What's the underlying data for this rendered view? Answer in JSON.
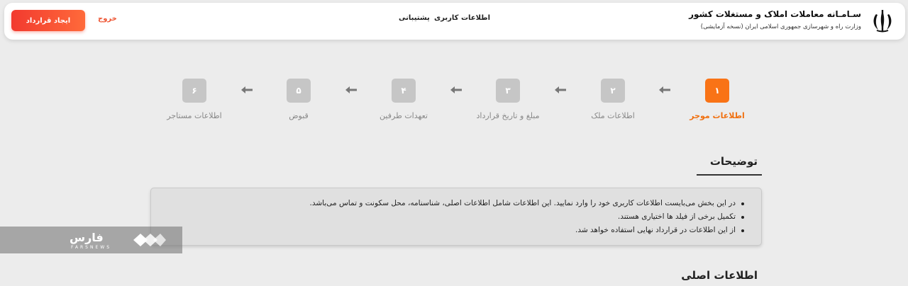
{
  "header": {
    "title": "سـامـانه معاملات املاک و مستغلات کشور",
    "subtitle": "وزارت راه و شهرسازی جمهوری اسلامی ایران (نسخه آزمایشی)",
    "nav": {
      "user_info": "اطلاعات کاربری",
      "support": "پشتیبانی"
    },
    "logout": "خروج",
    "create_contract": "ایجاد قرارداد"
  },
  "steps": [
    {
      "num": "۱",
      "label": "اطلاعات موجر",
      "active": true
    },
    {
      "num": "۲",
      "label": "اطلاعات ملک",
      "active": false
    },
    {
      "num": "۳",
      "label": "مبلغ و تاریخ قرارداد",
      "active": false
    },
    {
      "num": "۴",
      "label": "تعهدات طرفین",
      "active": false
    },
    {
      "num": "۵",
      "label": "قبوض",
      "active": false
    },
    {
      "num": "۶",
      "label": "اطلاعات مستاجر",
      "active": false
    }
  ],
  "description": {
    "title": "توضیحات",
    "items": [
      "در این بخش می‌بایست اطلاعات کاربری خود را وارد نمایید. این اطلاعات شامل اطلاعات اصلی، شناسنامه، محل سکونت و تماس می‌باشد.",
      "تکمیل برخی از فیلد ها اختیاری هستند.",
      "از این اطلاعات در قرارداد نهایی استفاده خواهد شد."
    ]
  },
  "main_section": {
    "title": "اطلاعات اصلی"
  },
  "watermark": {
    "text": "فارس",
    "sub": "FARSNEWS"
  },
  "colors": {
    "accent": "#f97316",
    "danger": "#f23a2f",
    "step_inactive": "#c6c6c6"
  }
}
